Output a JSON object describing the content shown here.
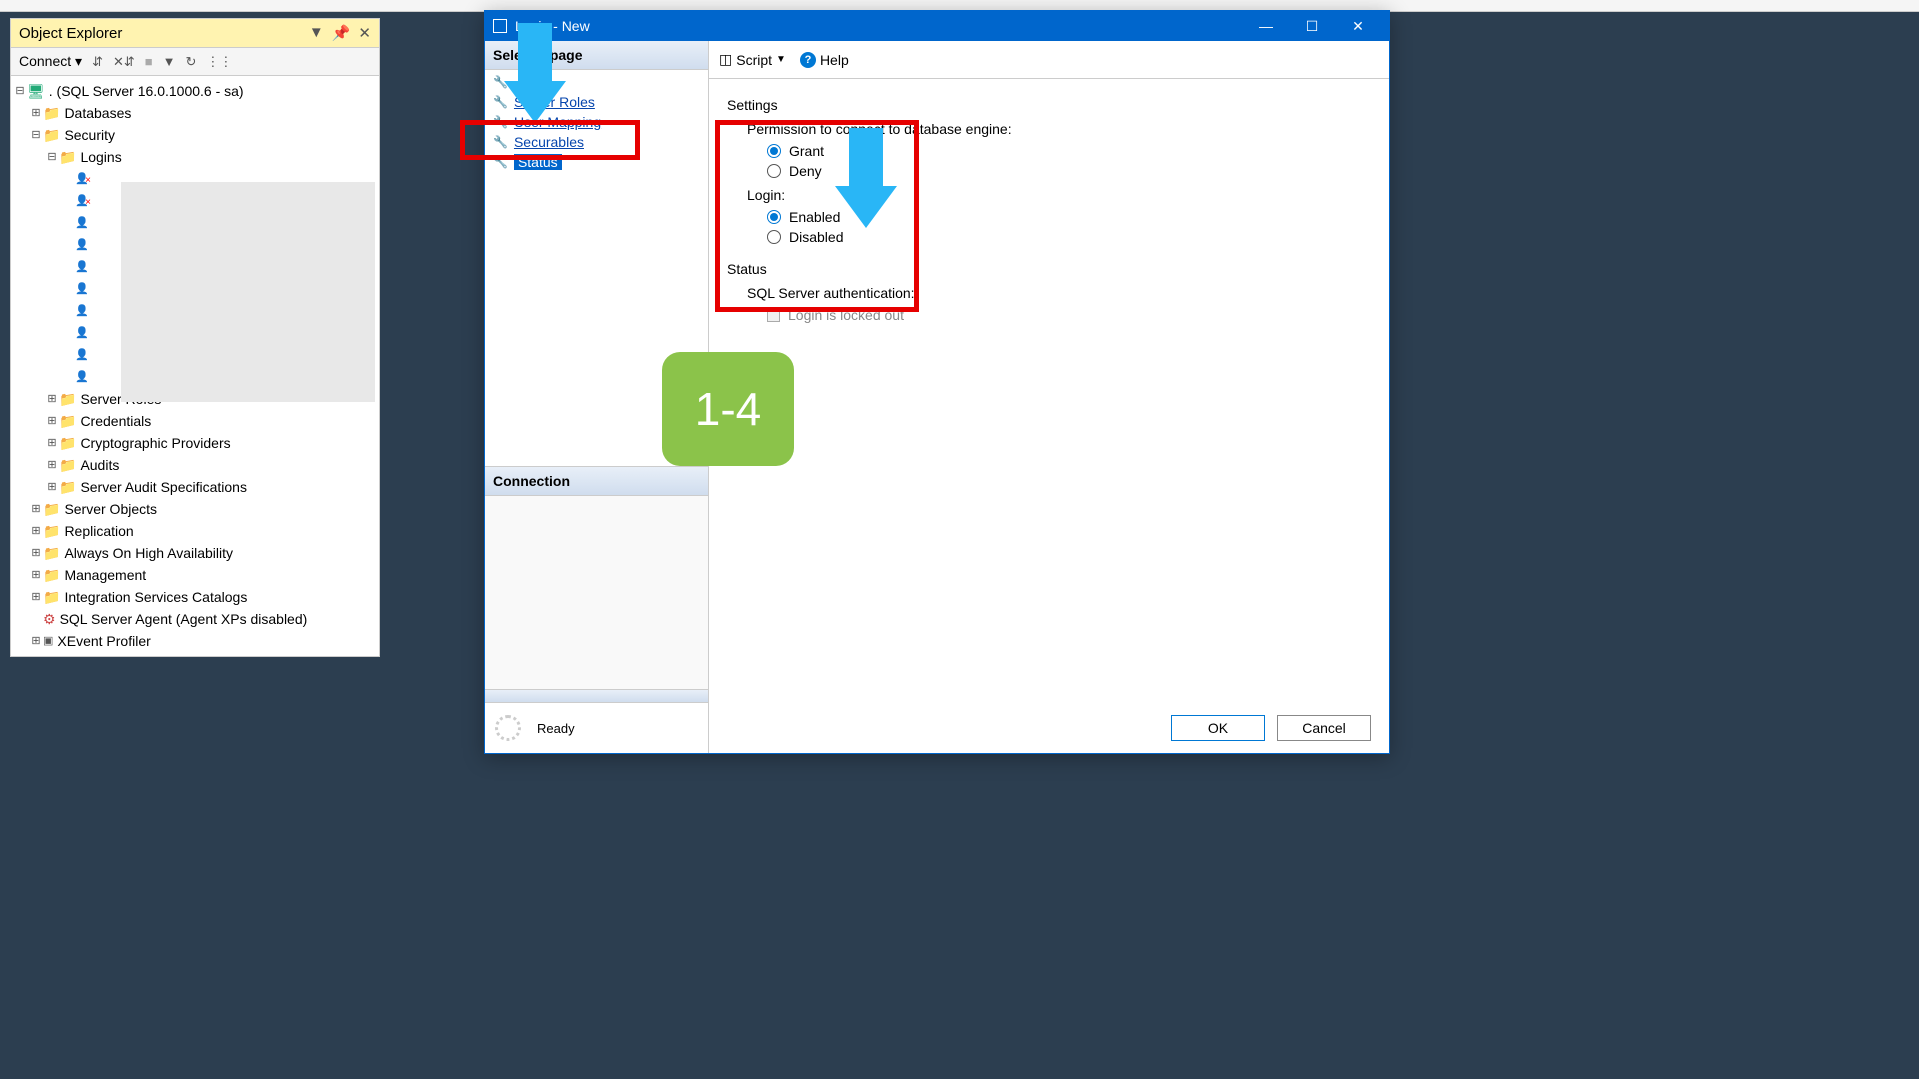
{
  "object_explorer": {
    "title": "Object Explorer",
    "connect_label": "Connect",
    "root": ". (SQL Server 16.0.1000.6 - sa)",
    "nodes": {
      "databases": "Databases",
      "security": "Security",
      "logins": "Logins",
      "server_roles": "Server Roles",
      "credentials": "Credentials",
      "crypto": "Cryptographic Providers",
      "audits": "Audits",
      "audit_specs": "Server Audit Specifications",
      "server_objects": "Server Objects",
      "replication": "Replication",
      "always_on": "Always On High Availability",
      "management": "Management",
      "isc": "Integration Services Catalogs",
      "agent": "SQL Server Agent (Agent XPs disabled)",
      "xevent": "XEvent Profiler"
    }
  },
  "dialog": {
    "title": "Login - New",
    "select_page": "Select a page",
    "pages": {
      "server_roles": "Server Roles",
      "user_mapping": "User Mapping",
      "securables": "Securables",
      "status": "Status"
    },
    "connection_header": "Connection",
    "progress_ready": "Ready",
    "toolbar": {
      "script": "Script",
      "help": "Help"
    },
    "content": {
      "settings": "Settings",
      "permission_label": "Permission to connect to database engine:",
      "grant": "Grant",
      "deny": "Deny",
      "login_label": "Login:",
      "enabled": "Enabled",
      "disabled": "Disabled",
      "status": "Status",
      "sql_auth": "SQL Server authentication:",
      "locked_out": "Login is locked out"
    },
    "buttons": {
      "ok": "OK",
      "cancel": "Cancel"
    }
  },
  "annotation": {
    "badge": "1-4"
  }
}
